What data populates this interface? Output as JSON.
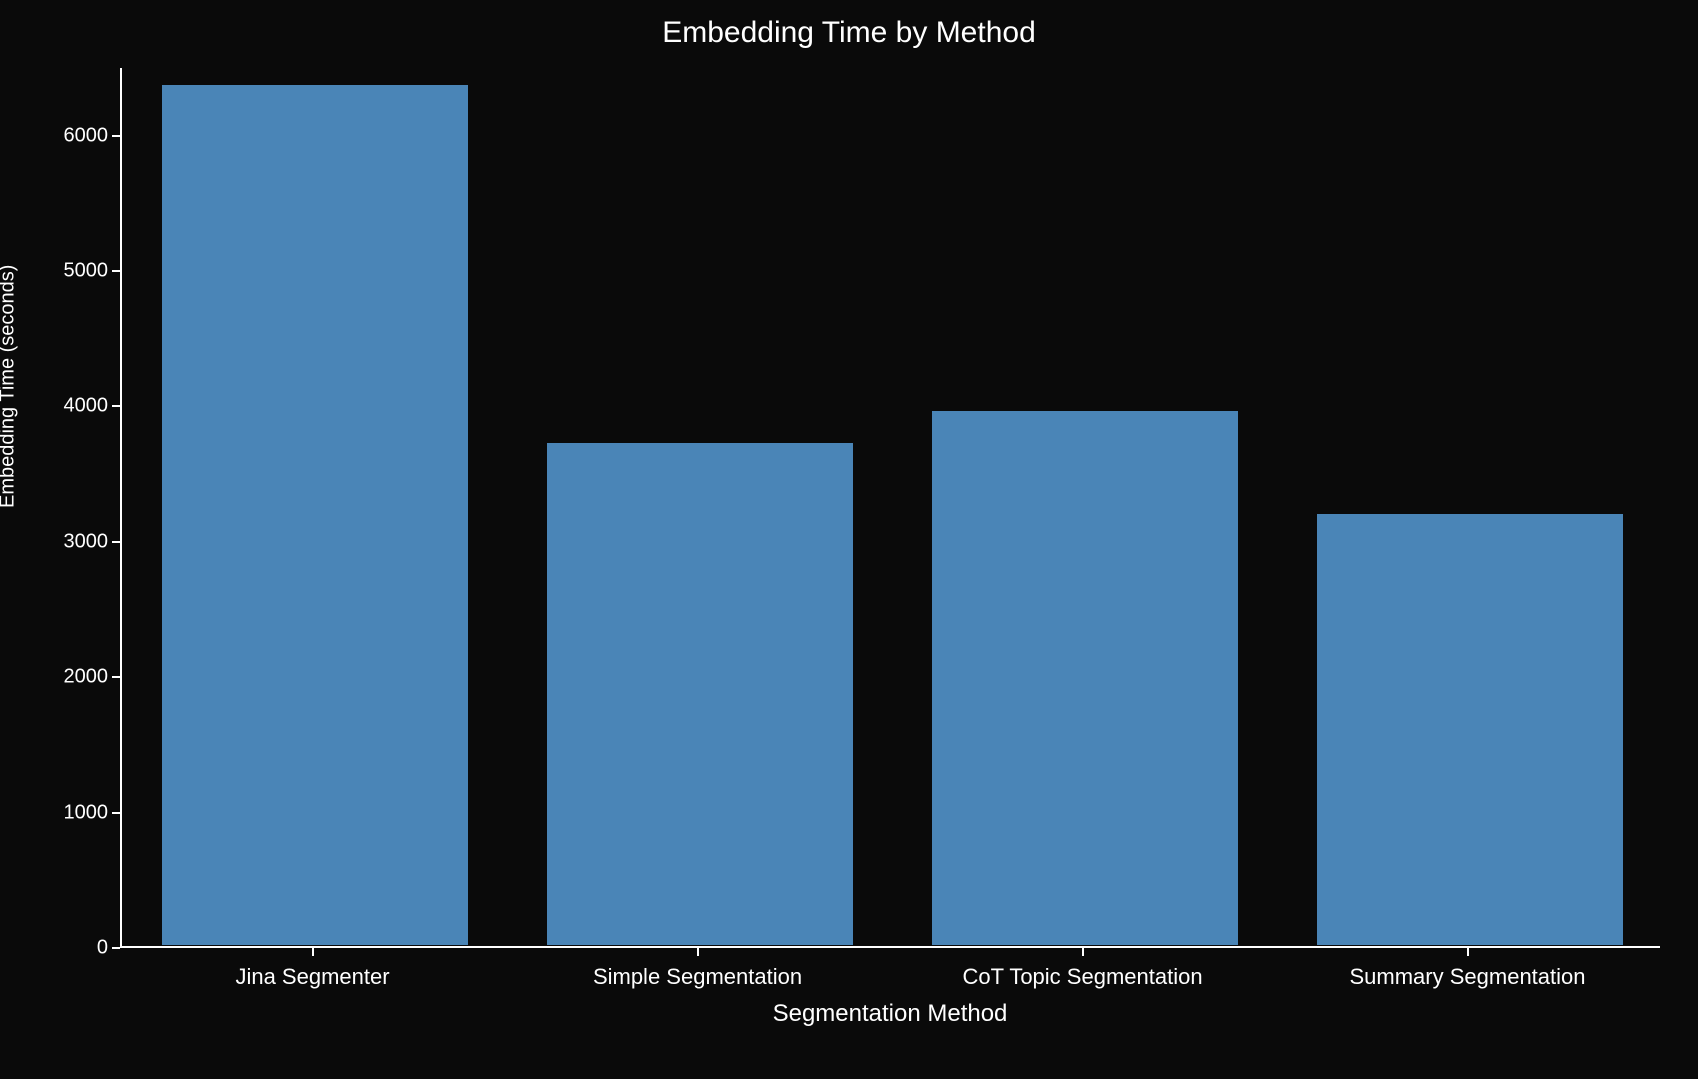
{
  "chart_data": {
    "type": "bar",
    "title": "Embedding Time by Method",
    "xlabel": "Segmentation Method",
    "ylabel": "Embedding Time (seconds)",
    "categories": [
      "Jina Segmenter",
      "Simple Segmentation",
      "CoT Topic Segmentation",
      "Summary Segmentation"
    ],
    "values": [
      6370,
      3720,
      3960,
      3200
    ],
    "ylim": [
      0,
      6500
    ],
    "yticks": [
      0,
      1000,
      2000,
      3000,
      4000,
      5000,
      6000
    ],
    "bar_color": "#4a85b7"
  }
}
